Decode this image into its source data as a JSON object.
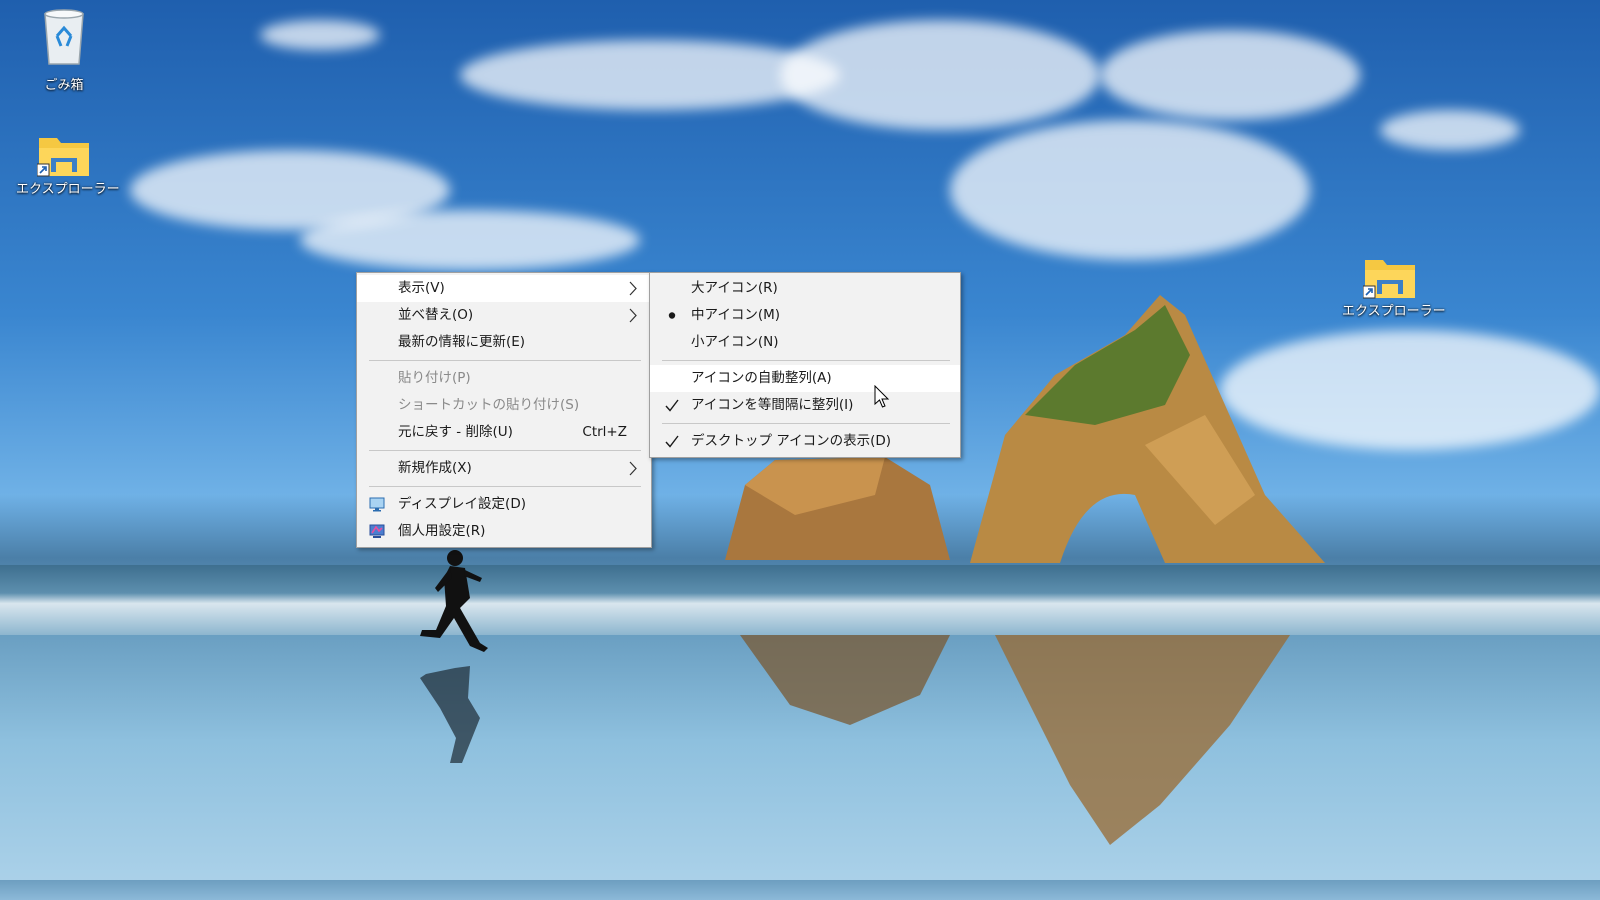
{
  "desktop": {
    "icons": [
      {
        "name": "recycle-bin",
        "label": "ごみ箱"
      },
      {
        "name": "explorer-shortcut-1",
        "label": "エクスプローラー"
      },
      {
        "name": "explorer-shortcut-2",
        "label": "エクスプローラー"
      }
    ]
  },
  "context_menu": {
    "items": [
      {
        "label": "表示(V)",
        "submenu": true,
        "highlighted": true
      },
      {
        "label": "並べ替え(O)",
        "submenu": true
      },
      {
        "label": "最新の情報に更新(E)"
      },
      {
        "label": "貼り付け(P)",
        "disabled": true
      },
      {
        "label": "ショートカットの貼り付け(S)",
        "disabled": true
      },
      {
        "label": "元に戻す - 削除(U)",
        "shortcut": "Ctrl+Z"
      },
      {
        "label": "新規作成(X)",
        "submenu": true
      },
      {
        "label": "ディスプレイ設定(D)",
        "icon": "display-settings-icon"
      },
      {
        "label": "個人用設定(R)",
        "icon": "personalize-icon"
      }
    ]
  },
  "view_submenu": {
    "items": [
      {
        "label": "大アイコン(R)"
      },
      {
        "label": "中アイコン(M)",
        "selected": true
      },
      {
        "label": "小アイコン(N)"
      },
      {
        "label": "アイコンの自動整列(A)",
        "highlighted": true
      },
      {
        "label": "アイコンを等間隔に整列(I)",
        "checked": true
      },
      {
        "label": "デスクトップ アイコンの表示(D)",
        "checked": true
      }
    ]
  },
  "colors": {
    "menu_bg": "#f2f2f2",
    "menu_highlight": "#ffffff",
    "menu_disabled_text": "#8a8a8a",
    "folder_yellow": "#f5c842"
  }
}
